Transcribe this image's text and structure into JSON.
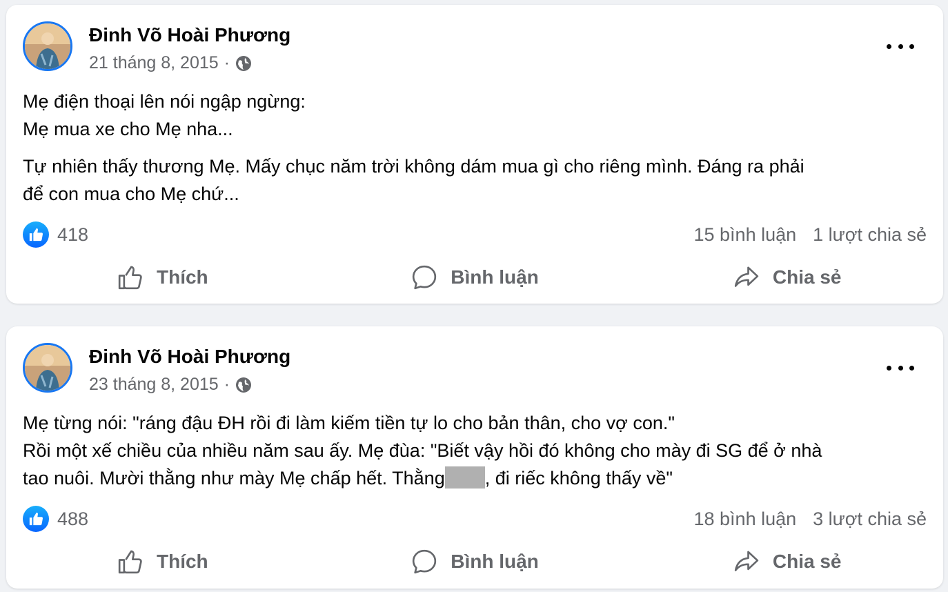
{
  "posts": [
    {
      "author": "Đinh Võ Hoài Phương",
      "date": "21 tháng 8, 2015",
      "separator": "·",
      "privacy_icon": "globe-icon",
      "content": {
        "lines_1": [
          "Mẹ điện thoại lên nói ngập ngừng:",
          "Mẹ mua xe cho Mẹ nha..."
        ],
        "lines_2": [
          "Tự nhiên thấy thương Mẹ. Mấy chục năm trời không dám mua gì cho riêng mình. Đáng ra phải",
          "để con mua cho Mẹ chứ..."
        ]
      },
      "reactions": "418",
      "comments": "15 bình luận",
      "shares": "1 lượt chia sẻ"
    },
    {
      "author": "Đinh Võ Hoài Phương",
      "date": "23 tháng 8, 2015",
      "separator": "·",
      "privacy_icon": "globe-icon",
      "content": {
        "line_1": "Mẹ từng nói: \"ráng đậu ĐH rồi đi làm kiếm tiền tự lo cho bản thân, cho vợ con.\"",
        "line_2": "Rồi một xế chiều của nhiều năm sau ấy. Mẹ đùa: \"Biết vậy hồi đó không cho mày đi SG để ở nhà",
        "line_3_before": "tao nuôi. Mười thằng như mày Mẹ chấp hết. Thằng",
        "line_3_after": ", đi riếc không thấy về\""
      },
      "reactions": "488",
      "comments": "18 bình luận",
      "shares": "3 lượt chia sẻ"
    }
  ],
  "actions": {
    "like": "Thích",
    "comment": "Bình luận",
    "share": "Chia sẻ"
  },
  "colors": {
    "background": "#f0f2f5",
    "card": "#ffffff",
    "accent": "#1877f2",
    "secondary_text": "#65676b"
  }
}
